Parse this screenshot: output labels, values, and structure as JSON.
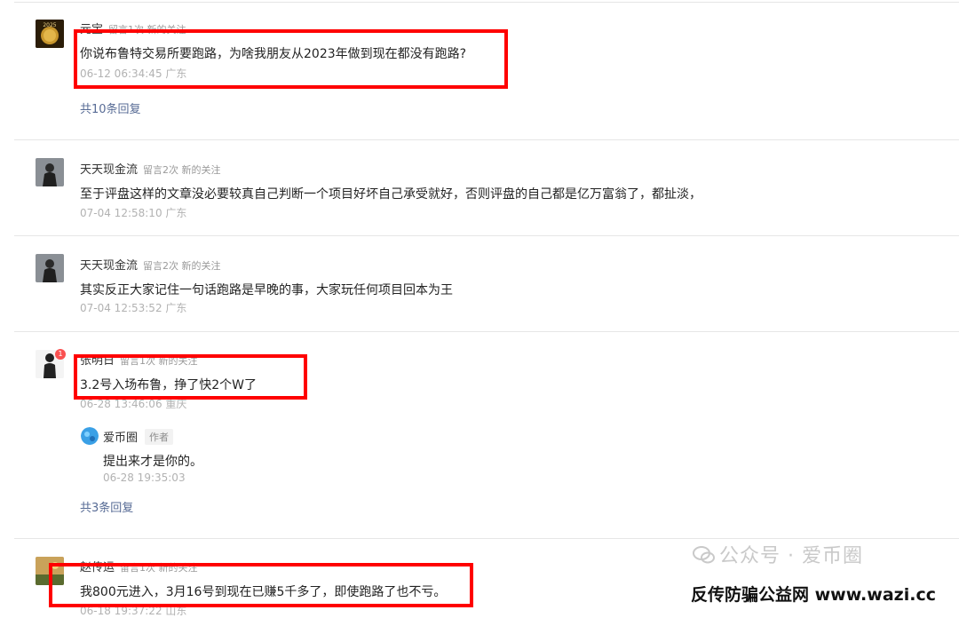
{
  "comments": [
    {
      "name": "元宝",
      "meta": "留言1次 新的关注",
      "content": "你说布鲁特交易所要跑路，为啥我朋友从2023年做到现在都没有跑路?",
      "time": "06-12 06:34:45 广东",
      "replies": "共10条回复",
      "avatar_icon": "coin-avatar-icon"
    },
    {
      "name": "天天现金流",
      "meta": "留言2次 新的关注",
      "content": "至于评盘这样的文章没必要较真自己判断一个项目好坏自己承受就好，否则评盘的自己都是亿万富翁了，都扯淡，",
      "time": "07-04 12:58:10 广东",
      "avatar_icon": "figure-avatar-icon"
    },
    {
      "name": "天天现金流",
      "meta": "留言2次 新的关注",
      "content": "其实反正大家记住一句话跑路是早晚的事，大家玩任何项目回本为王",
      "time": "07-04 12:53:52 广东",
      "avatar_icon": "figure-avatar-icon"
    },
    {
      "name": "张明日",
      "meta": "留言1次 新的关注",
      "content": "3.2号入场布鲁，挣了快2个W了",
      "time": "06-28 13:46:06 重庆",
      "badge": "1",
      "replies": "共3条回复",
      "reply": {
        "name": "爱币圈",
        "tag": "作者",
        "content": "提出来才是你的。",
        "time": "06-28 19:35:03"
      },
      "avatar_icon": "person-avatar-icon"
    },
    {
      "name": "赵传运",
      "meta": "留言1次 新的关注",
      "content": "我800元进入，3月16号到现在已赚5千多了，即使跑路了也不亏。",
      "time": "06-18 19:37:22 山东",
      "avatar_icon": "landscape-avatar-icon"
    }
  ],
  "watermark": {
    "line1": "公众号 · 爱币圈",
    "line2": "反传防骗公益网 www.wazi.cc"
  },
  "colors": {
    "highlight": "#ff0000",
    "link": "#576b95",
    "muted": "#b2b2b2"
  }
}
